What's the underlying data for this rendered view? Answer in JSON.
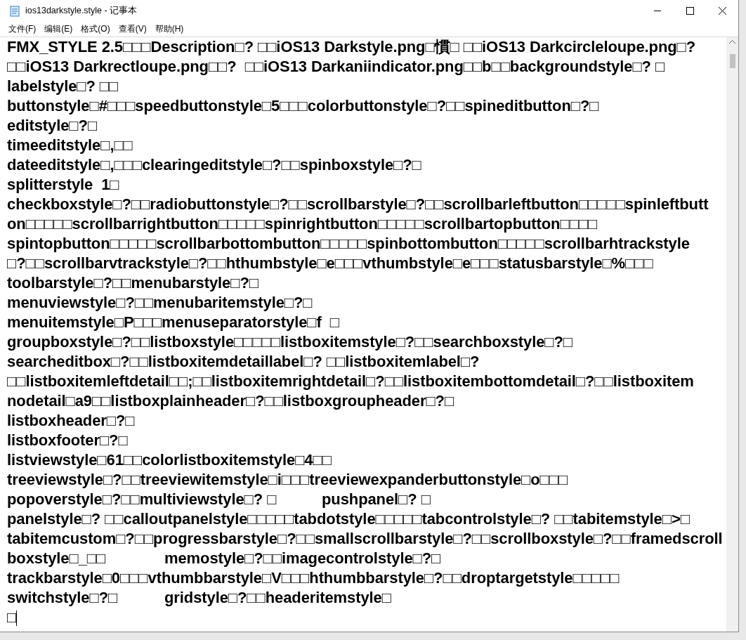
{
  "window": {
    "title": "ios13darkstyle.style - 记事本"
  },
  "menu": [
    "文件(F)",
    "编辑(E)",
    "格式(O)",
    "查看(V)",
    "帮助(H)"
  ],
  "editor": {
    "lines": [
      "FMX_STYLE 2.5□□□Description□? □□iOS13 Darkstyle.png□慣□ □□iOS13 Darkcircleloupe.png□?",
      "□□iOS13 Darkrectloupe.png□□?  □□iOS13 Darkaniindicator.png□□b□□backgroundstyle□? □",
      "labelstyle□? □□",
      "buttonstyle□#□□□speedbuttonstyle□5□□□colorbuttonstyle□?□□spineditbutton□?□",
      "editstyle□?□",
      "timeeditstyle□,□□",
      "dateeditstyle□,□□□clearingeditstyle□?□□spinboxstyle□?□",
      "splitterstyle  1□",
      "checkboxstyle□?□□radiobuttonstyle□?□□scrollbarstyle□?□□scrollbarleftbutton□□□□□spinleftbutt",
      "on□□□□□scrollbarrightbutton□□□□□spinrightbutton□□□□□scrollbartopbutton□□□□",
      "spintopbutton□□□□□scrollbarbottombutton□□□□□spinbottombutton□□□□□scrollbarhtrackstyle",
      "□?□□scrollbarvtrackstyle□?□□hthumbstyle□e□□□vthumbstyle□e□□□statusbarstyle□%□□□",
      "toolbarstyle□?□□menubarstyle□?□",
      "menuviewstyle□?□□menubaritemstyle□?□",
      "menuitemstyle□P□□□menuseparatorstyle□f  □",
      "groupboxstyle□?□□listboxstyle□□□□□listboxitemstyle□?□□searchboxstyle□?□",
      "searcheditbox□?□□listboxitemdetaillabel□? □□listboxitemlabel□?",
      "□□listboxitemleftdetail□□;□□listboxitemrightdetail□?□□listboxitembottomdetail□?□□listboxitem",
      "nodetail□a9□□listboxplainheader□?□□listboxgroupheader□?□",
      "listboxheader□?□",
      "listboxfooter□?□",
      "listviewstyle□61□□colorlistboxitemstyle□4□□",
      "treeviewstyle□?□□treeviewitemstyle□i□□□treeviewexpanderbuttonstyle□o□□□",
      "popoverstyle□?□□multiviewstyle□? □\tpushpanel□? □",
      "panelstyle□? □□calloutpanelstyle□□□□□tabdotstyle□□□□□tabcontrolstyle□? □□tabitemstyle□>□",
      "tabitemcustom□?□□progressbarstyle□?□□smallscrollbarstyle□?□□scrollboxstyle□?□□framedscroll",
      "boxstyle□_□□\tmemostyle□?□□imagecontrolstyle□?□",
      "trackbarstyle□0□□□vthumbbarstyle□V□□□hthumbbarstyle□?□□droptargetstyle□□□□□",
      "switchstyle□?□\tgridstyle□?□□headeritemstyle□",
      "□"
    ]
  }
}
